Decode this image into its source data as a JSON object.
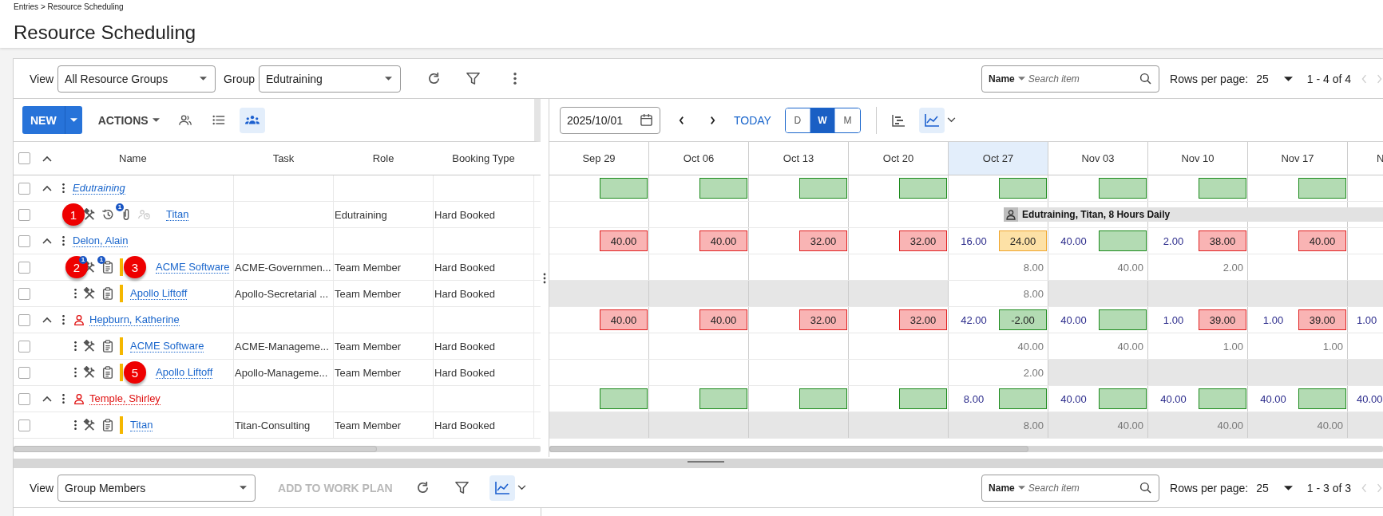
{
  "breadcrumb": "Entries > Resource Scheduling",
  "title": "Resource Scheduling",
  "toolbar": {
    "view_label": "View",
    "view_value": "All Resource Groups",
    "group_label": "Group",
    "group_value": "Edutraining",
    "search_field": "Name",
    "search_placeholder": "Search item",
    "rows_label": "Rows per page:",
    "rows_value": "25",
    "range": "1 - 4 of 4"
  },
  "grid_toolbar": {
    "new": "NEW",
    "actions": "ACTIONS",
    "modes": [
      {
        "kind": "people",
        "selected": false
      },
      {
        "kind": "list",
        "selected": false
      },
      {
        "kind": "group",
        "selected": true
      }
    ]
  },
  "calendar_toolbar": {
    "date": "2025/10/01",
    "today": "TODAY",
    "scales": [
      {
        "label": "D",
        "selected": false
      },
      {
        "label": "W",
        "selected": true
      },
      {
        "label": "M",
        "selected": false
      }
    ],
    "chart_selected": true
  },
  "table": {
    "all_checked": false,
    "all_expanded": true,
    "columns": [
      "Name",
      "Task",
      "Role",
      "Booking Type"
    ]
  },
  "weeks": [
    {
      "label": "Sep 29",
      "current": false
    },
    {
      "label": "Oct 06",
      "current": false
    },
    {
      "label": "Oct 13",
      "current": false
    },
    {
      "label": "Oct 20",
      "current": false
    },
    {
      "label": "Oct 27",
      "current": true
    },
    {
      "label": "Nov 03",
      "current": false
    },
    {
      "label": "Nov 10",
      "current": false
    },
    {
      "label": "Nov 17",
      "current": false
    },
    {
      "label": "N",
      "current": false
    }
  ],
  "rows": [
    {
      "kind": "group",
      "name": "Edutraining",
      "italic": true,
      "person_icon": false,
      "alert": false,
      "checked": false,
      "expanded": true,
      "cells": [
        {
          "kind": "ok"
        },
        {
          "kind": "ok"
        },
        {
          "kind": "ok"
        },
        {
          "kind": "ok"
        },
        {
          "kind": "ok"
        },
        {
          "kind": "ok"
        },
        {
          "kind": "ok"
        },
        {
          "kind": "ok"
        },
        {}
      ]
    },
    {
      "kind": "member",
      "name": "Titan",
      "task": "",
      "role": "Edutraining",
      "booking_type": "Hard Booked",
      "checked": false,
      "menu_callout": "1",
      "icons": [
        {
          "kind": "tools",
          "disabled": false
        },
        {
          "kind": "history",
          "disabled": false
        },
        {
          "kind": "attachment",
          "badge": "1",
          "disabled": false
        },
        {
          "kind": "person-clock",
          "disabled": true
        }
      ],
      "booking_label": "Edutraining, Titan, 8 Hours Daily",
      "cells": [
        {
          "booking": false,
          "shaded": false
        },
        {
          "booking": false,
          "shaded": false
        },
        {
          "booking": false,
          "shaded": false
        },
        {
          "booking": false,
          "shaded": false
        },
        {
          "booking": true,
          "shaded": false
        },
        {
          "booking": true,
          "shaded": false
        },
        {
          "booking": true,
          "shaded": false
        },
        {
          "booking": true,
          "shaded": false
        },
        {
          "booking": true,
          "shaded": false
        }
      ]
    },
    {
      "kind": "group",
      "name": "Delon, Alain",
      "italic": false,
      "person_icon": false,
      "alert": false,
      "checked": false,
      "expanded": true,
      "cells": [
        {
          "kind": "over",
          "value": "40.00"
        },
        {
          "kind": "over",
          "value": "40.00"
        },
        {
          "kind": "over",
          "value": "32.00"
        },
        {
          "kind": "over",
          "value": "32.00"
        },
        {
          "avail": "16.00",
          "kind": "warn",
          "value": "24.00"
        },
        {
          "avail": "40.00",
          "kind": "ok"
        },
        {
          "avail": "2.00",
          "kind": "over",
          "value": "38.00"
        },
        {
          "kind": "over",
          "value": "40.00"
        },
        {}
      ]
    },
    {
      "kind": "member",
      "name": "ACME Software",
      "task": "ACME-Governmen...",
      "role": "Team Member",
      "booking_type": "Hard Booked",
      "checked": false,
      "color": "#f5b700",
      "bar_callout": "3",
      "icons": [
        {
          "kind": "tools",
          "badge": "1",
          "callout": "2",
          "disabled": false
        },
        {
          "kind": "notes",
          "badge": "1",
          "disabled": false
        }
      ],
      "cells": [
        {
          "shaded": false
        },
        {
          "shaded": false
        },
        {
          "shaded": false
        },
        {
          "shaded": false
        },
        {
          "value": "8.00",
          "shaded": false
        },
        {
          "value": "40.00",
          "shaded": false
        },
        {
          "value": "2.00",
          "shaded": false
        },
        {
          "shaded": false
        },
        {
          "shaded": false
        }
      ]
    },
    {
      "kind": "member",
      "name": "Apollo Liftoff",
      "task": "Apollo-Secretarial ...",
      "role": "Team Member",
      "booking_type": "Hard Booked",
      "checked": false,
      "color": "#f5b700",
      "icons": [
        {
          "kind": "tools",
          "disabled": false
        },
        {
          "kind": "notes",
          "disabled": false
        }
      ],
      "cells": [
        {
          "shaded": true
        },
        {
          "shaded": true
        },
        {
          "shaded": true
        },
        {
          "shaded": true
        },
        {
          "value": "8.00",
          "shaded": false
        },
        {
          "shaded": true
        },
        {
          "shaded": true
        },
        {
          "shaded": true
        },
        {
          "shaded": true
        }
      ]
    },
    {
      "kind": "group",
      "name": "Hepburn, Katherine",
      "italic": false,
      "person_icon": true,
      "alert": false,
      "checked": false,
      "expanded": true,
      "cells": [
        {
          "kind": "over",
          "value": "40.00"
        },
        {
          "kind": "over",
          "value": "40.00"
        },
        {
          "kind": "over",
          "value": "32.00"
        },
        {
          "kind": "over",
          "value": "32.00"
        },
        {
          "avail": "42.00",
          "kind": "ok",
          "value": "-2.00"
        },
        {
          "avail": "40.00",
          "kind": "ok"
        },
        {
          "avail": "1.00",
          "kind": "over",
          "value": "39.00"
        },
        {
          "avail": "1.00",
          "kind": "over",
          "value": "39.00"
        },
        {
          "avail": "1.00"
        }
      ]
    },
    {
      "kind": "member",
      "name": "ACME Software",
      "task": "ACME-Manageme...",
      "role": "Team Member",
      "booking_type": "Hard Booked",
      "checked": false,
      "color": "#f5b700",
      "icons": [
        {
          "kind": "tools",
          "disabled": false
        },
        {
          "kind": "notes",
          "disabled": false
        }
      ],
      "cells": [
        {
          "shaded": false
        },
        {
          "shaded": false
        },
        {
          "shaded": false
        },
        {
          "shaded": false
        },
        {
          "value": "40.00",
          "shaded": false
        },
        {
          "value": "40.00",
          "shaded": false
        },
        {
          "value": "1.00",
          "shaded": false
        },
        {
          "value": "1.00",
          "shaded": false
        },
        {
          "shaded": false
        }
      ]
    },
    {
      "kind": "member",
      "name": "Apollo Liftoff",
      "task": "Apollo-Manageme...",
      "role": "Team Member",
      "booking_type": "Hard Booked",
      "checked": false,
      "color": "#f5b700",
      "bar_callout": "5",
      "icons": [
        {
          "kind": "tools",
          "disabled": false
        },
        {
          "kind": "notes",
          "disabled": false
        }
      ],
      "cells": [
        {
          "shaded": false
        },
        {
          "shaded": false
        },
        {
          "shaded": false
        },
        {
          "shaded": false
        },
        {
          "value": "2.00",
          "shaded": false
        },
        {
          "shaded": true
        },
        {
          "shaded": true
        },
        {
          "shaded": true
        },
        {
          "shaded": true
        }
      ]
    },
    {
      "kind": "group",
      "name": "Temple, Shirley",
      "italic": false,
      "person_icon": true,
      "alert": true,
      "checked": false,
      "expanded": true,
      "cells": [
        {
          "kind": "ok"
        },
        {
          "kind": "ok"
        },
        {
          "kind": "ok"
        },
        {
          "kind": "ok"
        },
        {
          "avail": "8.00",
          "kind": "ok"
        },
        {
          "avail": "40.00",
          "kind": "ok"
        },
        {
          "avail": "40.00",
          "kind": "ok"
        },
        {
          "avail": "40.00",
          "kind": "ok"
        },
        {
          "avail": "40.00"
        }
      ]
    },
    {
      "kind": "member",
      "name": "Titan",
      "task": "Titan-Consulting",
      "role": "Team Member",
      "booking_type": "Hard Booked",
      "checked": false,
      "color": "#f5b700",
      "icons": [
        {
          "kind": "tools",
          "disabled": false
        },
        {
          "kind": "notes",
          "disabled": false
        }
      ],
      "cells": [
        {
          "shaded": true
        },
        {
          "shaded": true
        },
        {
          "shaded": true
        },
        {
          "shaded": true
        },
        {
          "value": "8.00",
          "shaded": true
        },
        {
          "value": "40.00",
          "shaded": true
        },
        {
          "value": "40.00",
          "shaded": true
        },
        {
          "value": "40.00",
          "shaded": true
        },
        {
          "shaded": true
        }
      ]
    }
  ],
  "bottom_toolbar": {
    "view_label": "View",
    "view_value": "Group Members",
    "add": "ADD TO WORK PLAN",
    "add_disabled": true,
    "chart_selected": true,
    "search_field": "Name",
    "search_placeholder": "Search item",
    "rows_label": "Rows per page:",
    "rows_value": "25",
    "range": "1 - 3 of 3"
  }
}
